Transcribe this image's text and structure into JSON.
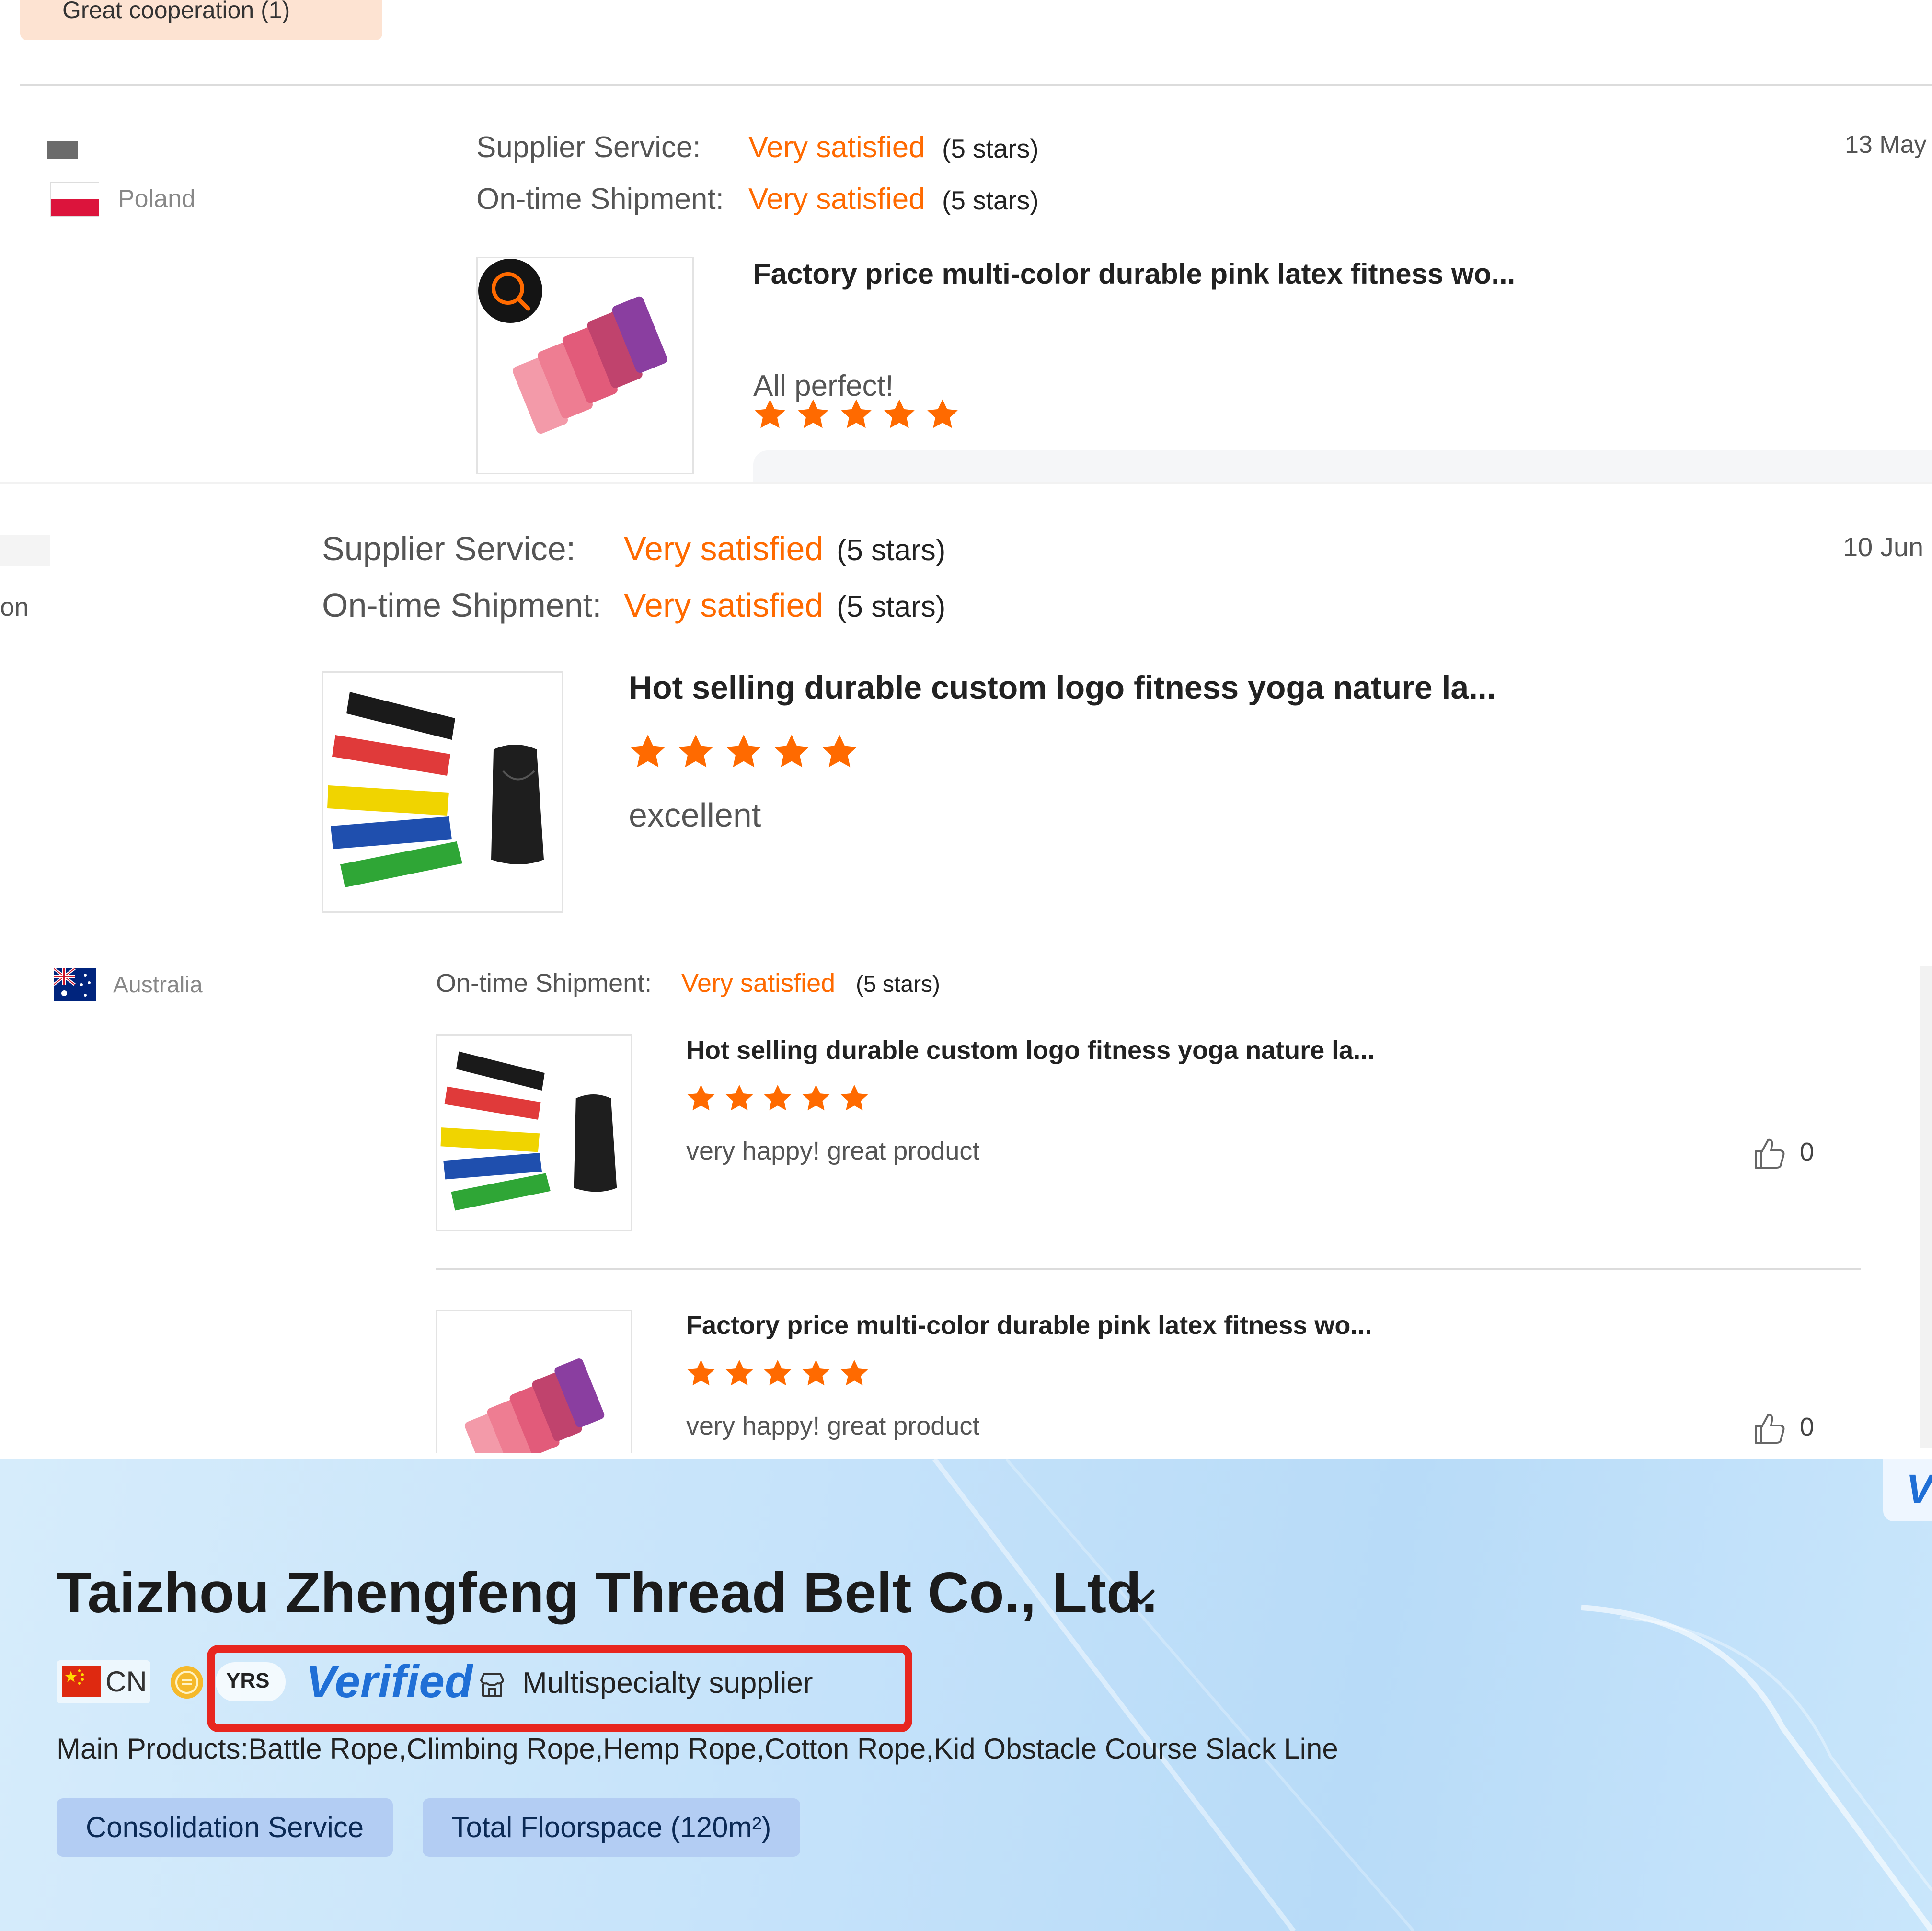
{
  "top_tag": {
    "label": "Great cooperation (1)"
  },
  "review_poland": {
    "country": "Poland",
    "date": "13 May",
    "supplier_service_label": "Supplier Service:",
    "supplier_service_value": "Very satisfied",
    "supplier_service_stars": "(5 stars)",
    "shipment_label": "On-time Shipment:",
    "shipment_value": "Very satisfied",
    "shipment_stars": "(5 stars)",
    "product_title": "Factory price multi-color durable pink latex fitness wo...",
    "rating": 5,
    "comment": "All perfect!"
  },
  "review_second": {
    "country_fragment": "on",
    "date": "10 Jun",
    "supplier_service_label": "Supplier Service:",
    "supplier_service_value": "Very satisfied",
    "supplier_service_stars": "(5 stars)",
    "shipment_label": "On-time Shipment:",
    "shipment_value": "Very satisfied",
    "shipment_stars": "(5 stars)",
    "product_title": "Hot selling durable custom logo fitness yoga nature la...",
    "rating": 5,
    "comment": "excellent"
  },
  "review_australia": {
    "country": "Australia",
    "shipment_label": "On-time Shipment:",
    "shipment_value": "Very satisfied",
    "shipment_stars": "(5 stars)",
    "items": [
      {
        "product_title": "Hot selling durable custom logo fitness yoga nature la...",
        "rating": 5,
        "comment": "very happy! great product",
        "likes": "0"
      },
      {
        "product_title": "Factory price multi-color durable pink latex fitness wo...",
        "rating": 5,
        "comment": "very happy! great product",
        "likes": "0"
      }
    ]
  },
  "supplier": {
    "company_name": "Taizhou Zhengfeng Thread Belt Co., Ltd.",
    "country_code": "CN",
    "years_badge": "YRS",
    "verified_label": "Verified",
    "supplier_type": "Multispecialty supplier",
    "main_products": "Main Products:Battle Rope,Climbing Rope,Hemp Rope,Cotton Rope,Kid Obstacle Course Slack Line",
    "chips": [
      "Consolidation Service",
      "Total Floorspace (120m²)"
    ],
    "corner_badge": "V"
  },
  "colors": {
    "accent_orange": "#ff6a00",
    "verified_blue": "#1f6fd6",
    "highlight_red": "#e8261f"
  },
  "icons": [
    "search-icon",
    "star-icon",
    "thumbs-up-icon",
    "chevron-down-icon",
    "store-icon",
    "flag-poland-icon",
    "flag-australia-icon",
    "flag-china-icon"
  ]
}
